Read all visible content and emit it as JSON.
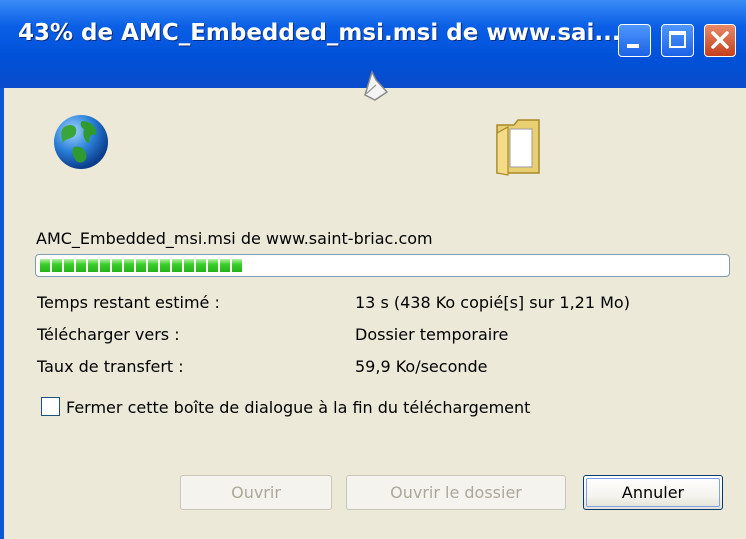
{
  "window": {
    "title": "43% de AMC_Embedded_msi.msi de www.sai...",
    "controls": [
      "minimize",
      "maximize",
      "close"
    ]
  },
  "animation": {
    "icons": [
      "paper-icon",
      "globe-icon",
      "folder-icon"
    ]
  },
  "download": {
    "source_line": "AMC_Embedded_msi.msi de www.saint-briac.com",
    "progress_percent": 43,
    "rows": [
      {
        "label": "Temps restant estimé :",
        "value": "13 s (438 Ko copié[s] sur 1,21 Mo)"
      },
      {
        "label": "Télécharger vers :",
        "value": "Dossier temporaire"
      },
      {
        "label": "Taux de transfert :",
        "value": "59,9 Ko/seconde"
      }
    ]
  },
  "options": {
    "close_on_finish_label": "Fermer cette boîte de dialogue à la fin du téléchargement",
    "close_on_finish_checked": false
  },
  "buttons": {
    "open": "Ouvrir",
    "open_folder": "Ouvrir le dossier",
    "cancel": "Annuler"
  },
  "colors": {
    "titlebar": "#0a5fe6",
    "dialog_background": "#ece9d8",
    "progress_green": "#23b318",
    "close_button": "#c53f1c"
  }
}
